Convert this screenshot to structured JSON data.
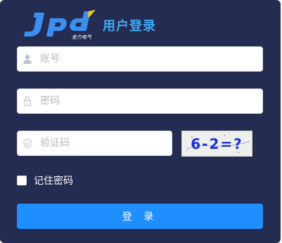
{
  "header": {
    "logo_text": "Jpd",
    "logo_subtext": "金力电气",
    "title": "用户登录"
  },
  "form": {
    "account_placeholder": "账号",
    "password_placeholder": "密码",
    "captcha_placeholder": "验证码",
    "captcha_image_text": "6-2=?",
    "remember_label": "记住密码",
    "remember_checked": false,
    "submit_label": "登 录"
  },
  "icons": {
    "account": "user-icon",
    "password": "lock-icon",
    "captcha": "shield-icon"
  },
  "colors": {
    "panel_bg": "#252c52",
    "title": "#3fa9f5",
    "button": "#1f8fff",
    "captcha_text": "#1d2fd6"
  }
}
